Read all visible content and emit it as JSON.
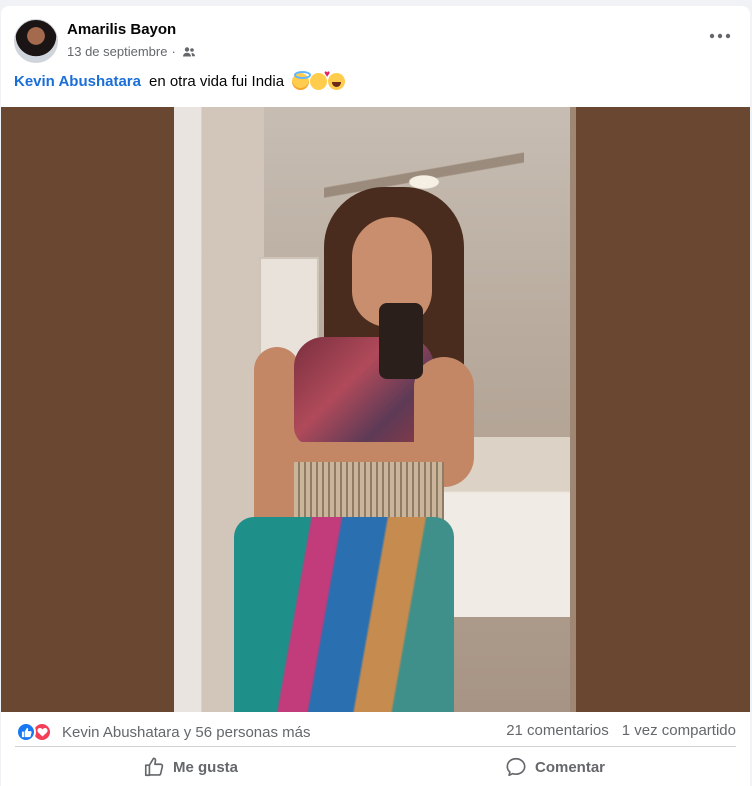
{
  "post": {
    "author": "Amarilis Bayon",
    "date": "13 de septiembre",
    "separator": "·",
    "audience_icon": "friends-icon",
    "more_label": "•••",
    "caption": {
      "mention": "Kevin Abushatara",
      "text": "en otra vida fui India",
      "emojis": [
        "smiling-face-with-halo",
        "smiling-face-with-hearts",
        "face-with-tears-of-joy"
      ]
    },
    "reactions": {
      "icons": [
        "like-reaction-icon",
        "love-reaction-icon"
      ],
      "summary": "Kevin Abushatara y 56 personas más"
    },
    "counts": {
      "comments": "21 comentarios",
      "shares": "1 vez compartido"
    },
    "actions": {
      "like_label": "Me gusta",
      "comment_label": "Comentar"
    }
  },
  "colors": {
    "mention": "#1a6ed8",
    "media_background": "#6a4731",
    "like_blue": "#1877f2",
    "love_red": "#f33e58",
    "secondary_text": "#65676b"
  }
}
